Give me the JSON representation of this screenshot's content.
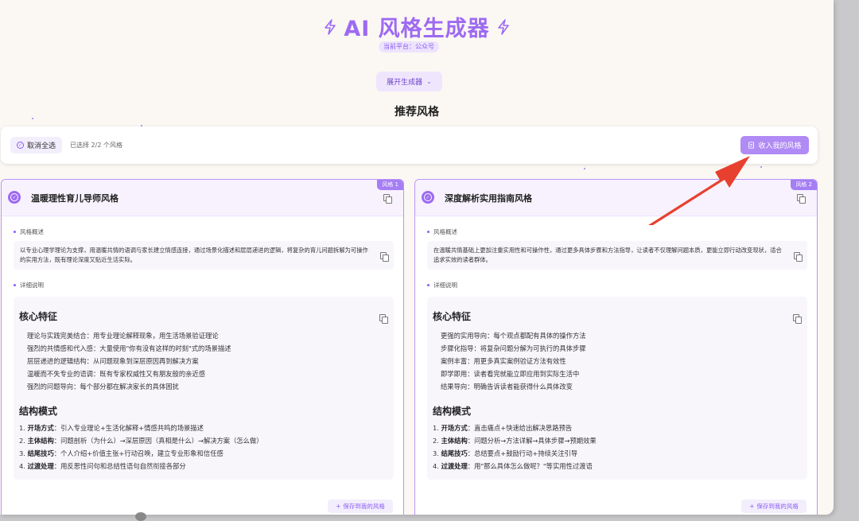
{
  "header": {
    "title": "AI 风格生成器",
    "platform": "当前平台：公众号",
    "expand_label": "展开生成器",
    "section_title": "推荐风格"
  },
  "toolbar": {
    "deselect_label": "取消全选",
    "selected_count": "已选择 2/2 个风格",
    "collect_label": "收入我的风格"
  },
  "labels": {
    "overview": "风格概述",
    "details": "详细说明",
    "core_features": "核心特征",
    "structure": "结构模式",
    "save": "保存到我的风格"
  },
  "cards": [
    {
      "tag": "风格 1",
      "title": "温暖理性育儿导师风格",
      "overview": "以专业心理学理论为支撑，用温暖共情的语调与家长建立情感连接，通过场景化描述和层层递进的逻辑，将复杂的育儿问题拆解为可操作的实用方法，既有理论深度又贴近生活实际。",
      "features": [
        "理论与实践完美结合：用专业理论解释现象，用生活场景验证理论",
        "强烈的共情感和代入感：大量使用\"你有没有这样的时刻\"式的场景描述",
        "层层递进的逻辑结构：从问题现象到深层原因再到解决方案",
        "温暖而不失专业的语调：既有专家权威性又有朋友般的亲近感",
        "强烈的问题导向：每个部分都在解决家长的具体困扰"
      ],
      "structure": [
        {
          "num": "1.",
          "key": "开场方式",
          "value": "：引入专业理论+生活化解释+情感共鸣的场景描述"
        },
        {
          "num": "2.",
          "key": "主体结构",
          "value": "：问题剖析（为什么）→深层原因（真相是什么）→解决方案（怎么做）"
        },
        {
          "num": "3.",
          "key": "结尾技巧",
          "value": "：个人介绍+价值主张+行动召唤，建立专业形象和信任感"
        },
        {
          "num": "4.",
          "key": "过渡处理",
          "value": "：用反思性问句和总结性语句自然衔接各部分"
        }
      ]
    },
    {
      "tag": "风格 2",
      "title": "深度解析实用指南风格",
      "overview": "在温暖共情基础上更加注重实用性和可操作性，通过更多具体步骤和方法指导，让读者不仅理解问题本质，更能立即行动改变现状，适合追求实效的读者群体。",
      "features": [
        "更强的实用导向：每个观点都配有具体的操作方法",
        "步骤化指导：将复杂问题分解为可执行的具体步骤",
        "案例丰富：用更多真实案例验证方法有效性",
        "即学即用：读者看完就能立即应用到实际生活中",
        "结果导向：明确告诉读者能获得什么具体改变"
      ],
      "structure": [
        {
          "num": "1.",
          "key": "开场方式",
          "value": "：直击痛点+快速给出解决思路预告"
        },
        {
          "num": "2.",
          "key": "主体结构",
          "value": "：问题分析→方法详解→具体步骤→预期效果"
        },
        {
          "num": "3.",
          "key": "结尾技巧",
          "value": "：总结要点+鼓励行动+持续关注引导"
        },
        {
          "num": "4.",
          "key": "过渡处理",
          "value": "：用\"那么具体怎么做呢？\"等实用性过渡语"
        }
      ]
    }
  ],
  "colors": {
    "accent": "#9d6af2",
    "accent_light": "#efe6fd",
    "card_border": "#b995f6",
    "arrow": "#e8402f"
  }
}
